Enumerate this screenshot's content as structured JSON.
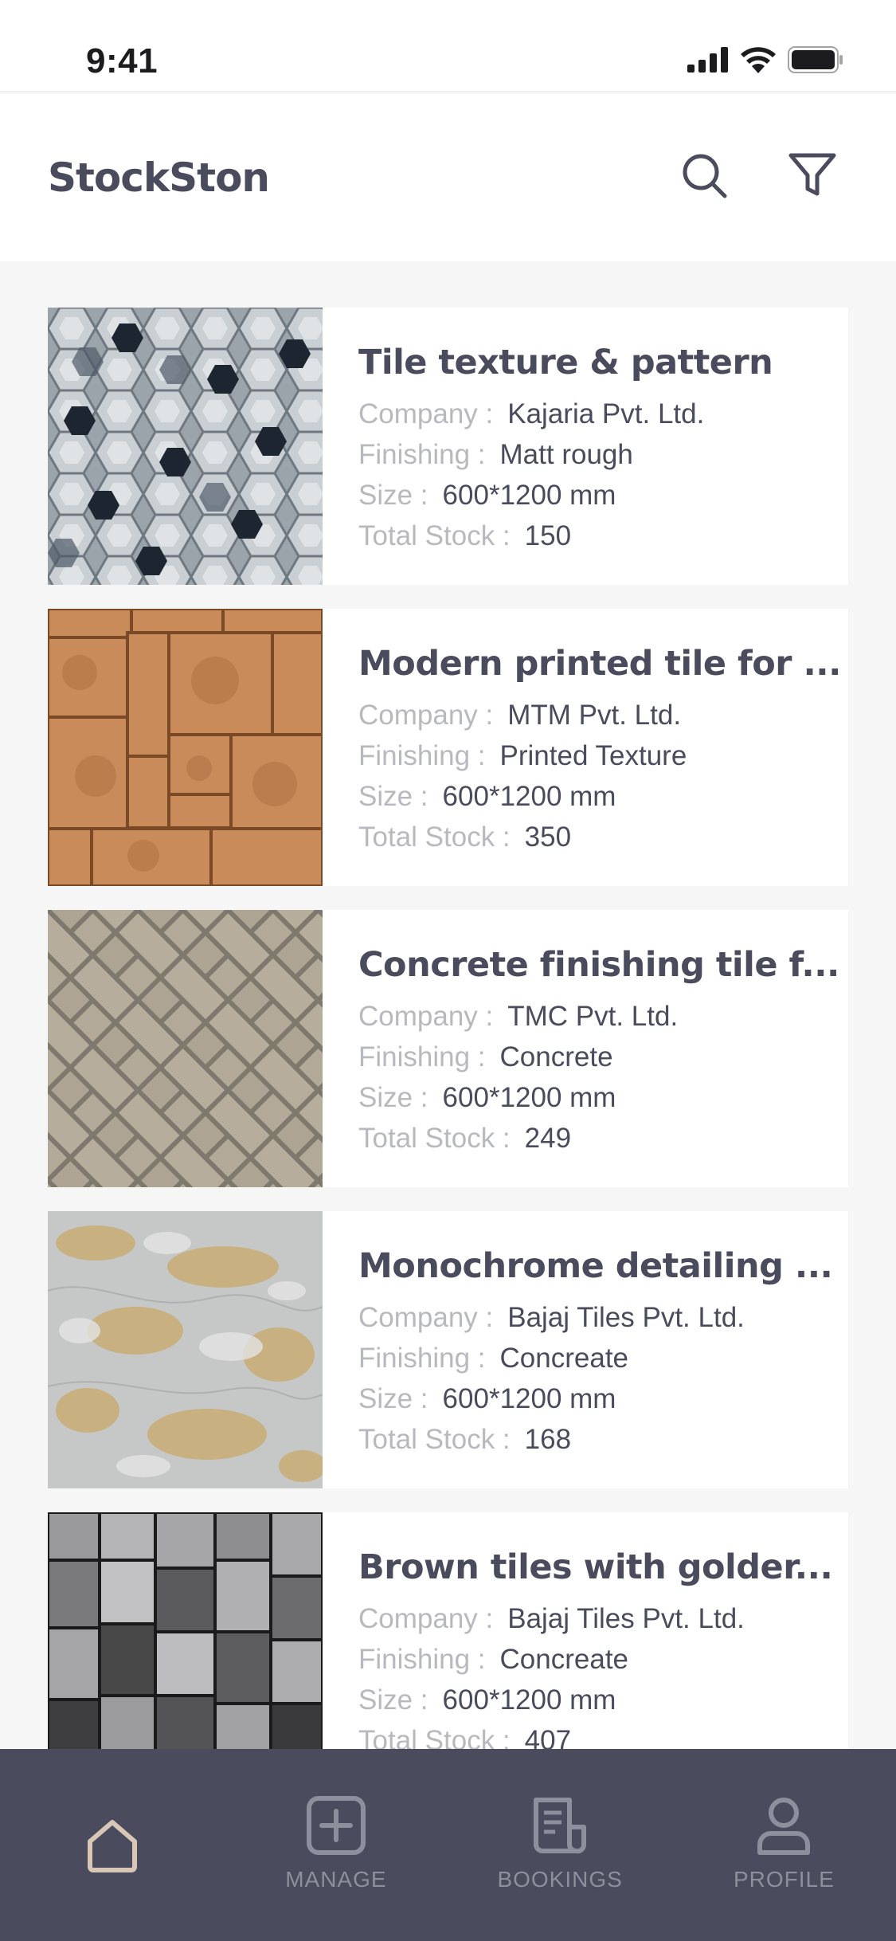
{
  "status_bar": {
    "time": "9:41"
  },
  "header": {
    "title": "StockSton"
  },
  "labels": {
    "company": "Company :",
    "finishing": "Finishing :",
    "size": "Size :",
    "stock": "Total Stock :"
  },
  "products": [
    {
      "title": "Tile texture & pattern",
      "company": "Kajaria Pvt. Ltd.",
      "finishing": "Matt rough",
      "size": "600*1200 mm",
      "stock": "150"
    },
    {
      "title": "Modern printed tile for ...",
      "company": "MTM Pvt. Ltd.",
      "finishing": "Printed Texture",
      "size": "600*1200 mm",
      "stock": "350"
    },
    {
      "title": "Concrete finishing tile f...",
      "company": "TMC Pvt. Ltd.",
      "finishing": "Concrete",
      "size": "600*1200 mm",
      "stock": "249"
    },
    {
      "title": "Monochrome detailing ...",
      "company": "Bajaj Tiles Pvt. Ltd.",
      "finishing": "Concreate",
      "size": "600*1200 mm",
      "stock": "168"
    },
    {
      "title": "Brown tiles with golder...",
      "company": "Bajaj Tiles Pvt. Ltd.",
      "finishing": "Concreate",
      "size": "600*1200 mm",
      "stock": "407"
    }
  ],
  "nav": {
    "manage": "MANAGE",
    "bookings": "BOOKINGS",
    "profile": "PROFILE"
  },
  "colors": {
    "primary": "#4a4b5c",
    "muted": "#b8b8bf",
    "nav_active": "#d8c6b6",
    "nav_inactive": "#8e8f9c"
  }
}
